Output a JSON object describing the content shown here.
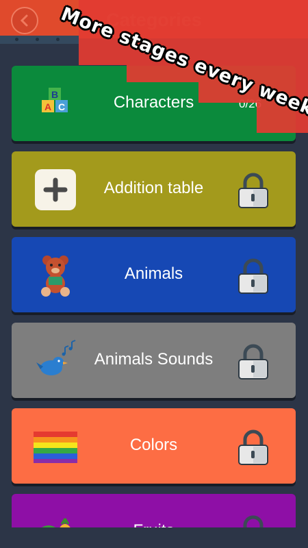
{
  "header": {
    "title": "Categories",
    "back_icon": "back-arrow-icon"
  },
  "promo": {
    "text": "More stages every week",
    "color": "#e23b32"
  },
  "categories": [
    {
      "label": "Characters",
      "progress": "0/26",
      "color": "#0b8a3c",
      "icon": "abc-blocks-icon",
      "locked": false
    },
    {
      "label": "Addition table",
      "color": "#a39a1c",
      "icon": "plus-tile-icon",
      "locked": true
    },
    {
      "label": "Animals",
      "color": "#1648b4",
      "icon": "teddy-bear-icon",
      "locked": true
    },
    {
      "label": "Animals Sounds",
      "color": "#7e7e7e",
      "icon": "singing-bird-icon",
      "locked": true
    },
    {
      "label": "Colors",
      "color": "#fd6d44",
      "icon": "rainbow-flag-icon",
      "locked": true
    },
    {
      "label": "Fruits",
      "color": "#8e0fa6",
      "icon": "fruits-icon",
      "locked": true
    }
  ]
}
